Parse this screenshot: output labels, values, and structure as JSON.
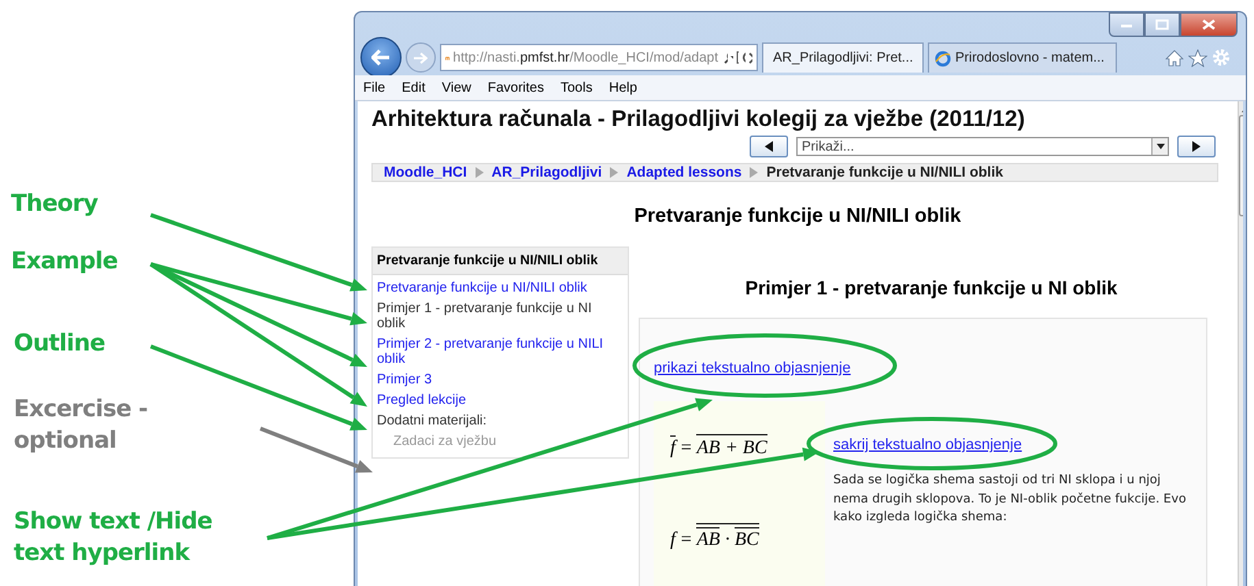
{
  "annotations": [
    {
      "text": "Theory",
      "color": "#1fae45"
    },
    {
      "text": "Example",
      "color": "#1fae45"
    },
    {
      "text": "Outline",
      "color": "#1fae45"
    },
    {
      "text": "Excercise - optional",
      "color": "#7f7f7f"
    },
    {
      "text": "Show text /Hide text hyperlink",
      "color": "#1fae45"
    }
  ],
  "browser": {
    "address": {
      "scheme_host": "http://nasti.",
      "domain": "pmfst.hr",
      "path": "/Moodle_HCI/mod/adapt"
    },
    "tabs": [
      {
        "label": "AR_Prilagodljivi: Pret...",
        "selected": true,
        "kind": "moodle"
      },
      {
        "label": "Prirodoslovno - matem...",
        "selected": false,
        "kind": "ie"
      }
    ],
    "menu": [
      "File",
      "Edit",
      "View",
      "Favorites",
      "Tools",
      "Help"
    ]
  },
  "page": {
    "course_title": "Arhitektura računala - Prilagodljivi kolegij za vježbe (2011/12)",
    "jump_select": {
      "value": "Prikaži..."
    },
    "breadcrumb": [
      "Moodle_HCI",
      "AR_Prilagodljivi",
      "Adapted lessons",
      "Pretvaranje funkcije u NI/NILI oblik"
    ],
    "title": "Pretvaranje funkcije u NI/NILI oblik",
    "lesson_menu": {
      "heading": "Pretvaranje funkcije u NI/NILI oblik",
      "items": [
        {
          "label": "Pretvaranje funkcije u NI/NILI oblik",
          "kind": "link",
          "selected": false
        },
        {
          "label": "Primjer 1 - pretvaranje funkcije u NI oblik",
          "kind": "link",
          "selected": true
        },
        {
          "label": "Primjer 2 - pretvaranje funkcije u NILI oblik",
          "kind": "link",
          "selected": false
        },
        {
          "label": "Primjer 3",
          "kind": "link",
          "selected": false
        },
        {
          "label": "Pregled lekcije",
          "kind": "link",
          "selected": false
        },
        {
          "label": "Dodatni materijali:",
          "kind": "label",
          "selected": false
        },
        {
          "label": "Zadaci za vježbu",
          "kind": "disabled",
          "selected": false
        }
      ]
    },
    "section_title": "Primjer 1 - pretvaranje funkcije u NI oblik",
    "show_link": "prikazi tekstualno objasnjenje",
    "hide_link": "sakrij tekstualno objasnjenje",
    "formulas": [
      {
        "lhs": "f",
        "lhs_bar": true,
        "relation": "=",
        "rhs_bar": true,
        "rhs": [
          {
            "text": "AB",
            "bar": false
          },
          {
            "text": " + ",
            "bar": false
          },
          {
            "text": "BC",
            "bar": false
          }
        ]
      },
      {
        "lhs": "f",
        "lhs_bar": false,
        "relation": "=",
        "rhs_bar": true,
        "rhs": [
          {
            "text": "AB",
            "bar": true
          },
          {
            "text": " · ",
            "bar": false
          },
          {
            "text": "BC",
            "bar": true
          }
        ]
      }
    ],
    "explanation": "Sada se logička shema sastoji od tri NI sklopa i u njoj nema drugih sklopova. To je NI-oblik početne fukcije. Evo kako izgleda logička shema:"
  }
}
